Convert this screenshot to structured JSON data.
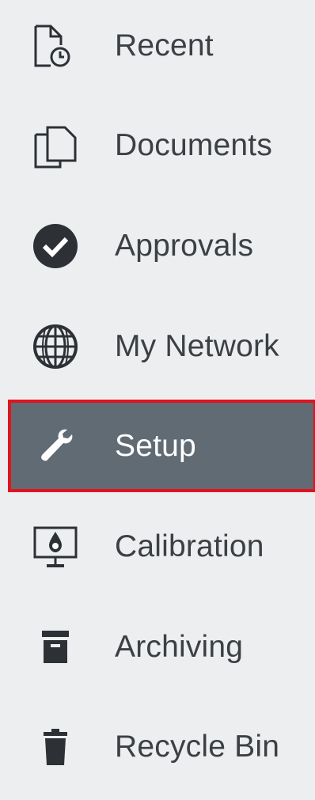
{
  "sidebar": {
    "items": [
      {
        "label": "Recent",
        "icon": "recent-document-clock-icon"
      },
      {
        "label": "Documents",
        "icon": "documents-icon"
      },
      {
        "label": "Approvals",
        "icon": "check-circle-icon"
      },
      {
        "label": "My Network",
        "icon": "globe-icon"
      },
      {
        "label": "Setup",
        "icon": "wrench-icon",
        "active": true
      },
      {
        "label": "Calibration",
        "icon": "monitor-calibration-icon"
      },
      {
        "label": "Archiving",
        "icon": "archive-box-icon"
      },
      {
        "label": "Recycle Bin",
        "icon": "trash-icon"
      }
    ]
  },
  "colors": {
    "sidebar_bg": "#edeef0",
    "text": "#3c4045",
    "icon": "#2d3136",
    "active_bg": "#606b74",
    "active_border": "#e0141e",
    "active_text": "#ffffff"
  }
}
